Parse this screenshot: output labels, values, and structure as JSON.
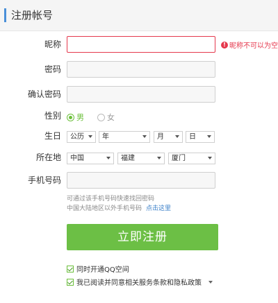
{
  "header": {
    "title": "注册帐号"
  },
  "form": {
    "nickname": {
      "label": "昵称",
      "value": "",
      "error": "昵称不可以为空"
    },
    "password": {
      "label": "密码",
      "value": ""
    },
    "confirm_password": {
      "label": "确认密码",
      "value": ""
    },
    "gender": {
      "label": "性别",
      "options": [
        "男",
        "女"
      ],
      "selected": "男"
    },
    "birthday": {
      "label": "生日",
      "calendar": "公历",
      "year": "年",
      "month": "月",
      "day": "日"
    },
    "location": {
      "label": "所在地",
      "country": "中国",
      "province": "福建",
      "city": "厦门"
    },
    "phone": {
      "label": "手机号码",
      "value": "",
      "hint1": "可通过该手机号码快速找回密码",
      "hint2": "中国大陆地区以外手机号码",
      "hint2_link": "点击这里"
    },
    "submit_label": "立即注册",
    "agree_qzone": "同时开通QQ空间",
    "agree_terms": "我已阅读并同意相关服务条款和隐私政策"
  },
  "colors": {
    "accent": "#6cbf45",
    "error": "#e5374c",
    "link": "#3a7fc8",
    "header_bar": "#4a90d9"
  }
}
